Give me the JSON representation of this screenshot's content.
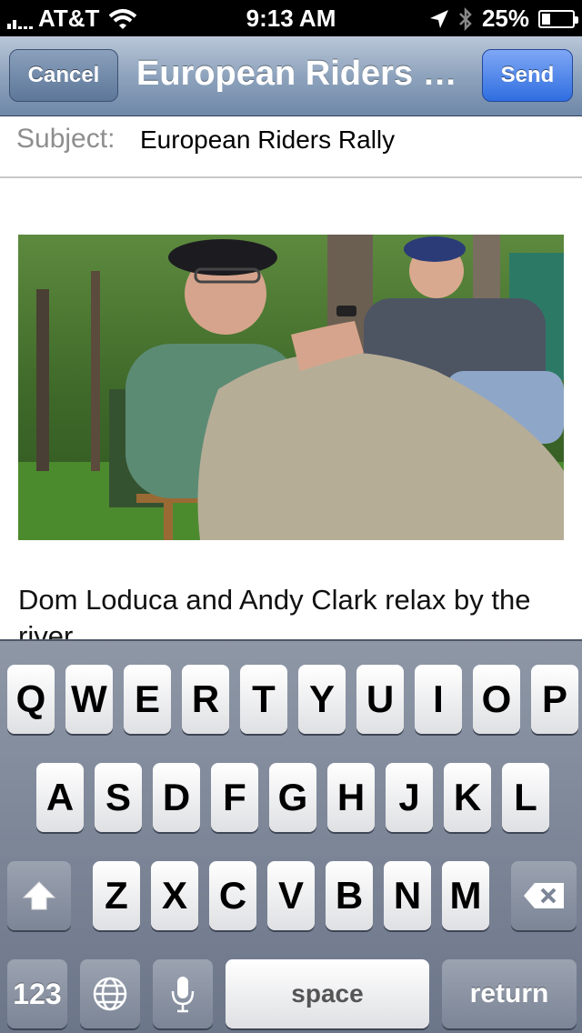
{
  "status": {
    "carrier": "AT&T",
    "time": "9:13 AM",
    "battery": "25%"
  },
  "nav": {
    "cancel": "Cancel",
    "title": "European Riders Rally",
    "send": "Send"
  },
  "subject": {
    "label": "Subject:",
    "value": "European Riders Rally"
  },
  "body": {
    "caption": "Dom Loduca and Andy Clark relax by the river"
  },
  "keyboard": {
    "row1": [
      "Q",
      "W",
      "E",
      "R",
      "T",
      "Y",
      "U",
      "I",
      "O",
      "P"
    ],
    "row2": [
      "A",
      "S",
      "D",
      "F",
      "G",
      "H",
      "J",
      "K",
      "L"
    ],
    "row3": [
      "Z",
      "X",
      "C",
      "V",
      "B",
      "N",
      "M"
    ],
    "numbers": "123",
    "space": "space",
    "return": "return"
  },
  "colors": {
    "send": "#2f6ee0",
    "nav": "#8ea3bd"
  }
}
